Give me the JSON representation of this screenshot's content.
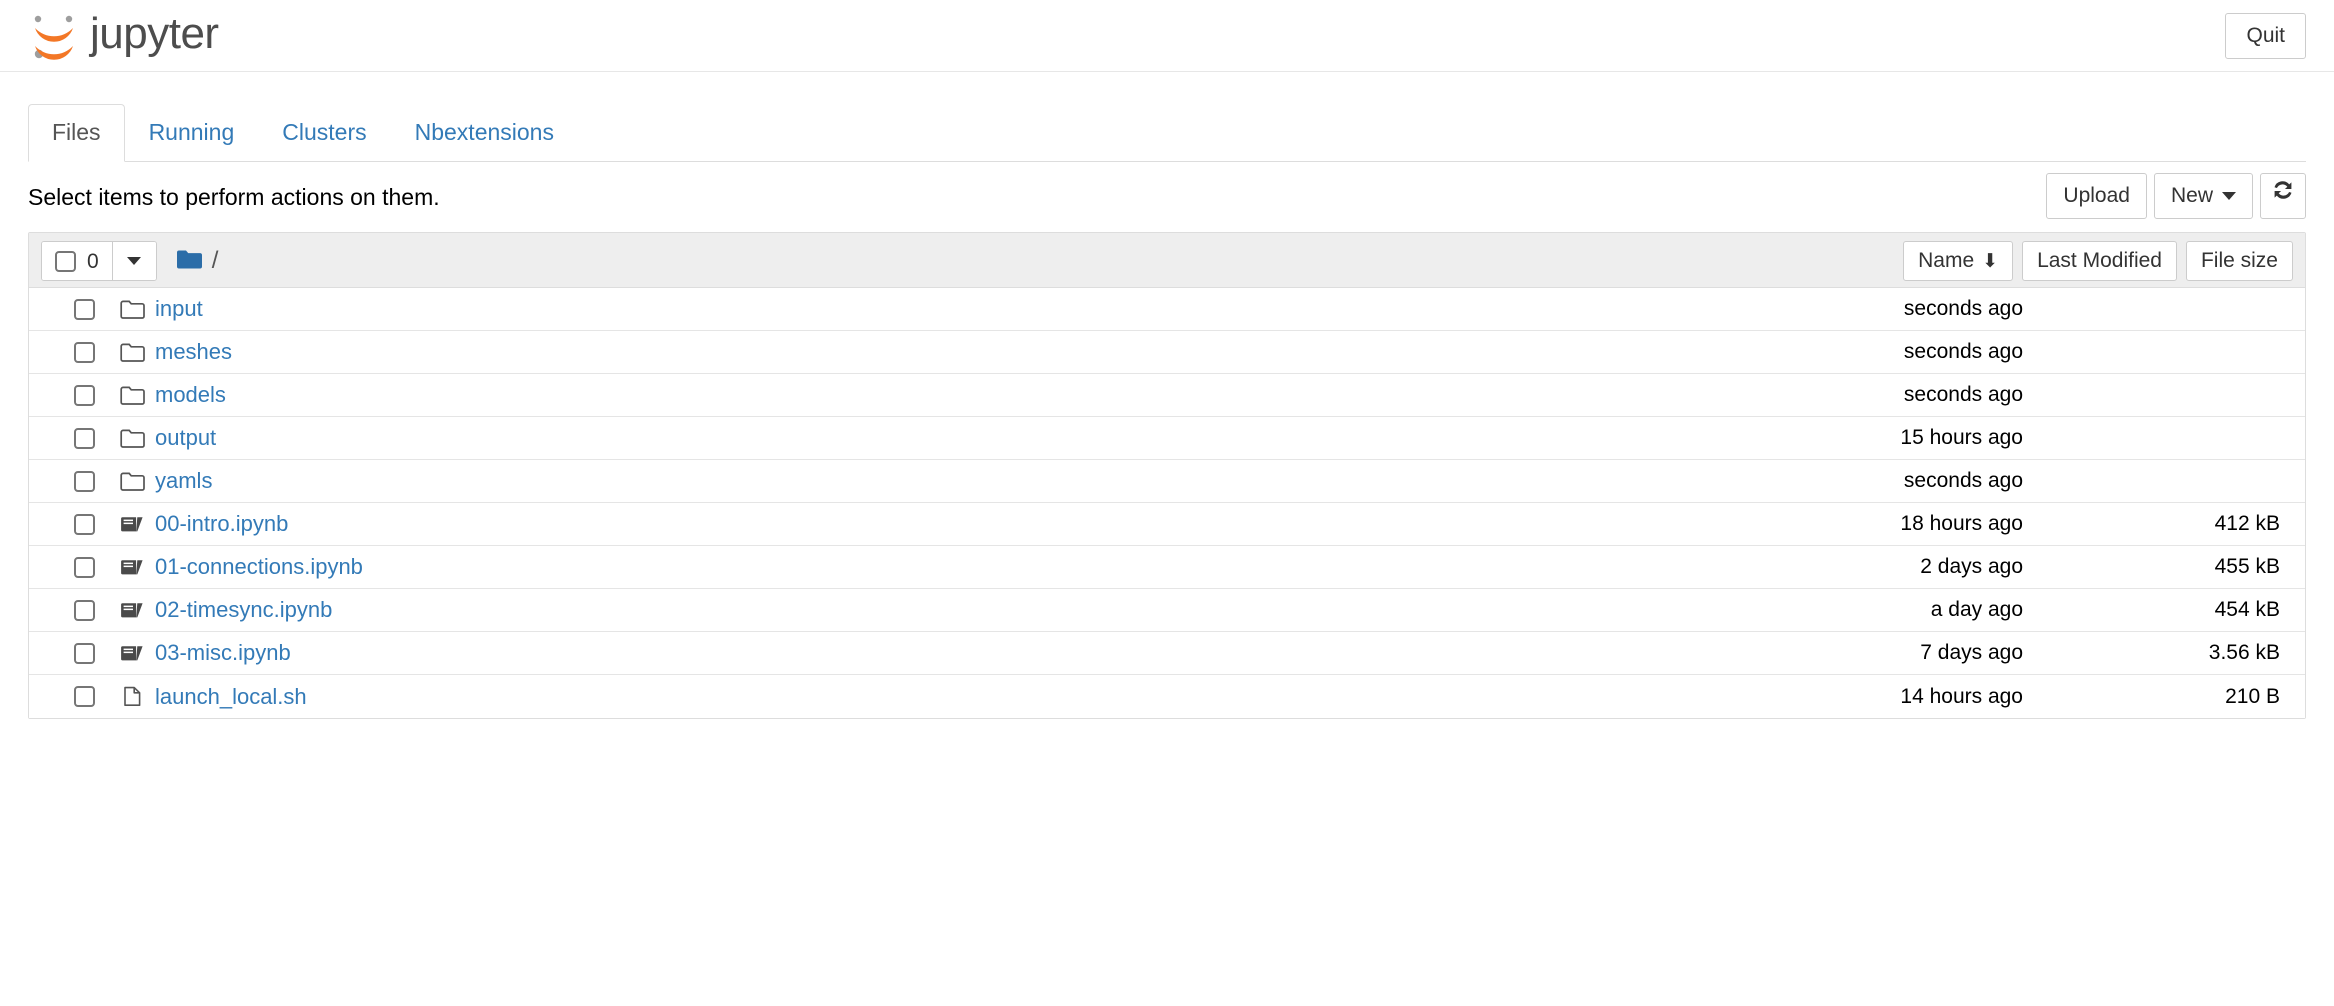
{
  "header": {
    "brand_text": "jupyter",
    "logo_icon": "jupyter-logo",
    "quit_label": "Quit"
  },
  "tabs": [
    {
      "label": "Files",
      "active": true
    },
    {
      "label": "Running",
      "active": false
    },
    {
      "label": "Clusters",
      "active": false
    },
    {
      "label": "Nbextensions",
      "active": false
    }
  ],
  "toolbar": {
    "hint_text": "Select items to perform actions on them.",
    "upload_label": "Upload",
    "new_label": "New",
    "new_caret_icon": "chevron-down-icon",
    "refresh_icon": "refresh-icon"
  },
  "list_header": {
    "select_all_checkbox_icon": "checkbox-unchecked-icon",
    "selected_count": "0",
    "select_dropdown_icon": "chevron-down-icon",
    "breadcrumb_folder_icon": "folder-filled-icon",
    "breadcrumb_path": "/",
    "sort_name_label": "Name",
    "sort_name_arrow": "⬇",
    "sort_modified_label": "Last Modified",
    "sort_size_label": "File size"
  },
  "files": [
    {
      "name": "input",
      "type": "folder",
      "icon": "folder-icon",
      "modified": "seconds ago",
      "size": ""
    },
    {
      "name": "meshes",
      "type": "folder",
      "icon": "folder-icon",
      "modified": "seconds ago",
      "size": ""
    },
    {
      "name": "models",
      "type": "folder",
      "icon": "folder-icon",
      "modified": "seconds ago",
      "size": ""
    },
    {
      "name": "output",
      "type": "folder",
      "icon": "folder-icon",
      "modified": "15 hours ago",
      "size": ""
    },
    {
      "name": "yamls",
      "type": "folder",
      "icon": "folder-icon",
      "modified": "seconds ago",
      "size": ""
    },
    {
      "name": "00-intro.ipynb",
      "type": "notebook",
      "icon": "notebook-icon",
      "modified": "18 hours ago",
      "size": "412 kB"
    },
    {
      "name": "01-connections.ipynb",
      "type": "notebook",
      "icon": "notebook-icon",
      "modified": "2 days ago",
      "size": "455 kB"
    },
    {
      "name": "02-timesync.ipynb",
      "type": "notebook",
      "icon": "notebook-icon",
      "modified": "a day ago",
      "size": "454 kB"
    },
    {
      "name": "03-misc.ipynb",
      "type": "notebook",
      "icon": "notebook-icon",
      "modified": "7 days ago",
      "size": "3.56 kB"
    },
    {
      "name": "launch_local.sh",
      "type": "file",
      "icon": "file-icon",
      "modified": "14 hours ago",
      "size": "210 B"
    }
  ],
  "colors": {
    "link_blue": "#337ab7",
    "logo_orange": "#f37726",
    "logo_gray": "#9e9e9e",
    "folder_blue": "#2b6da8",
    "header_strip": "#eeeeee",
    "border_gray": "#dddddd"
  }
}
